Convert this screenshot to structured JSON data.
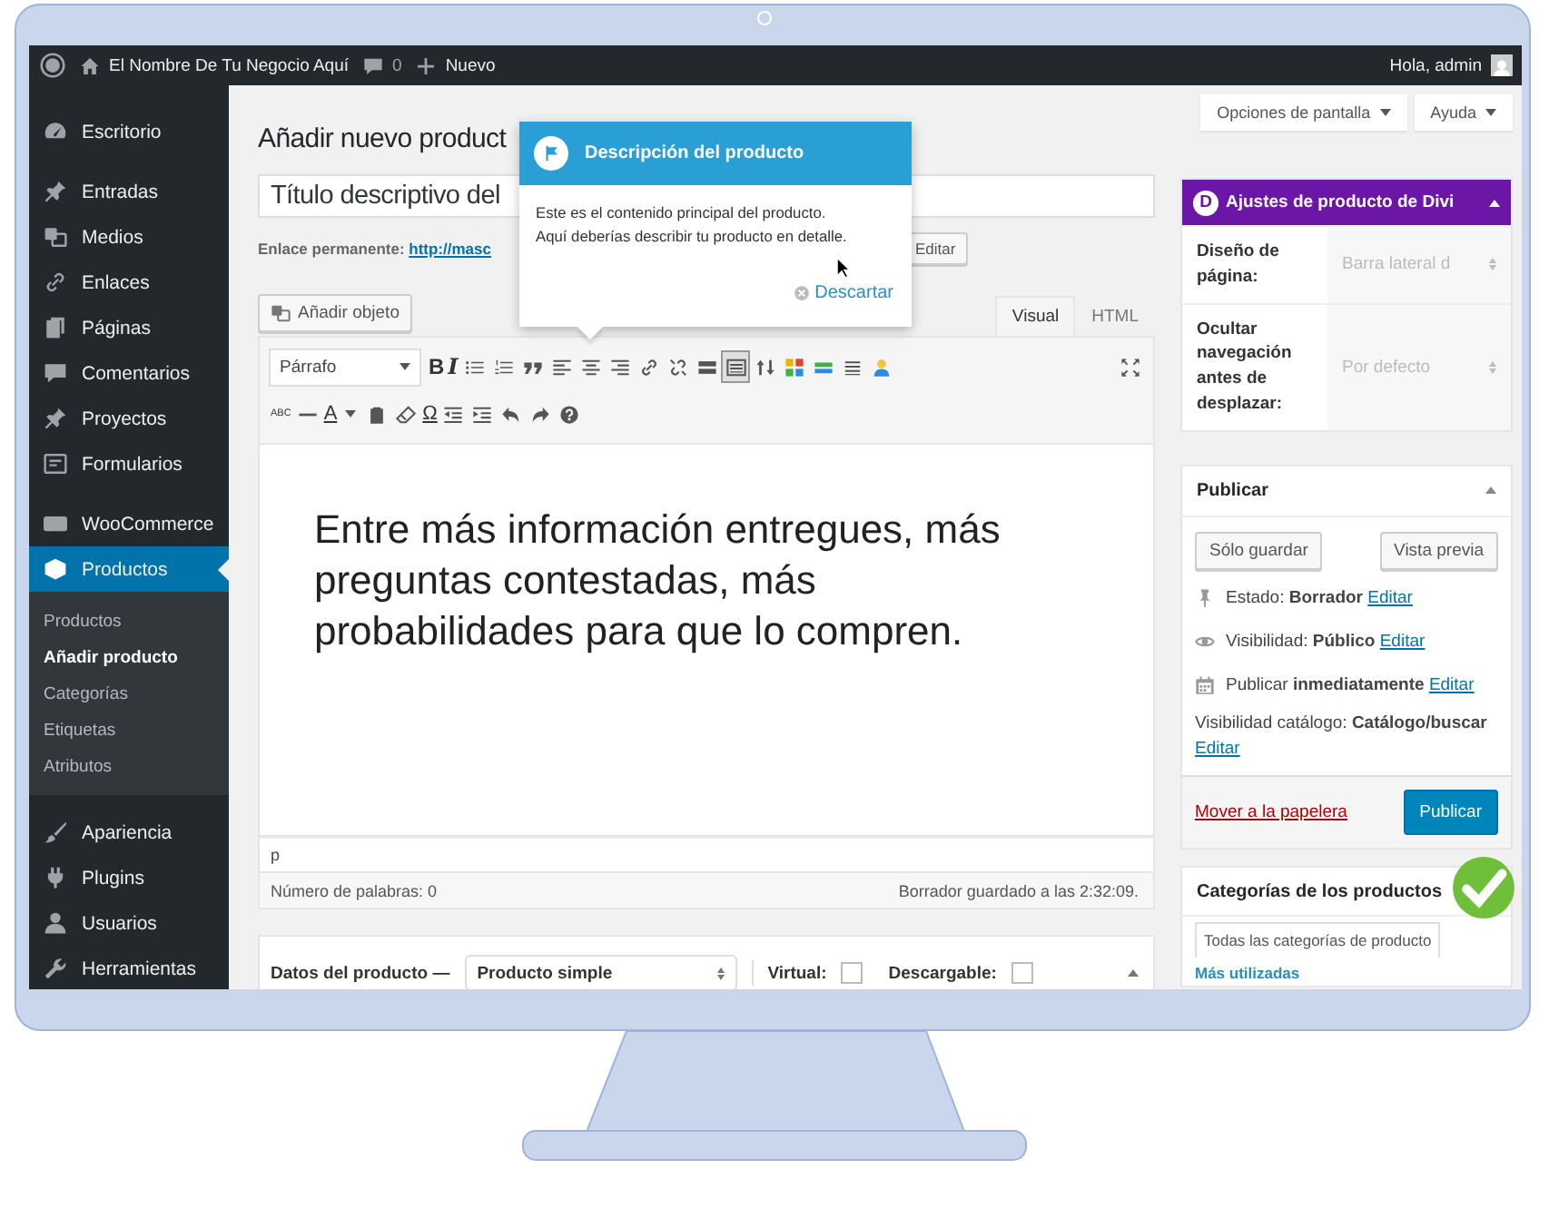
{
  "admin_bar": {
    "site_name": "El Nombre De Tu Negocio Aquí",
    "comments_count": "0",
    "new_label": "Nuevo",
    "greeting": "Hola, admin"
  },
  "sidebar": {
    "groups": [
      [
        {
          "label": "Escritorio",
          "selected": false
        }
      ],
      [
        {
          "label": "Entradas",
          "selected": false
        },
        {
          "label": "Medios",
          "selected": false
        },
        {
          "label": "Enlaces",
          "selected": false
        },
        {
          "label": "Páginas",
          "selected": false
        },
        {
          "label": "Comentarios",
          "selected": false
        },
        {
          "label": "Proyectos",
          "selected": false
        },
        {
          "label": "Formularios",
          "selected": false
        }
      ],
      [
        {
          "label": "WooCommerce",
          "selected": false
        },
        {
          "label": "Productos",
          "selected": true,
          "children": [
            {
              "label": "Productos",
              "selected": false
            },
            {
              "label": "Añadir producto",
              "selected": true
            },
            {
              "label": "Categorías",
              "selected": false
            },
            {
              "label": "Etiquetas",
              "selected": false
            },
            {
              "label": "Atributos",
              "selected": false
            }
          ]
        }
      ],
      [
        {
          "label": "Apariencia",
          "selected": false
        },
        {
          "label": "Plugins",
          "selected": false
        },
        {
          "label": "Usuarios",
          "selected": false
        },
        {
          "label": "Herramientas",
          "selected": false
        }
      ]
    ]
  },
  "screen_buttons": [
    "Opciones de pantalla",
    "Ayuda"
  ],
  "page_title": "Añadir nuevo product",
  "title_field": {
    "value": "Título descriptivo del"
  },
  "permalink": {
    "label": "Enlace permanente:",
    "url": "http://masc",
    "edit_button": "Editar"
  },
  "popover": {
    "title": "Descripción del producto",
    "lines": [
      "Este es el contenido principal del producto.",
      "Aquí deberías describir tu producto en detalle."
    ],
    "dismiss": "Descartar"
  },
  "editor": {
    "add_media": "Añadir objeto",
    "tabs": [
      {
        "label": "Visual",
        "selected": true
      },
      {
        "label": "HTML",
        "selected": false
      }
    ],
    "format": "Párrafo",
    "toolbar_rows": [
      [
        {
          "kind": "glyph",
          "label": "B",
          "pressed": false
        },
        {
          "kind": "glyph",
          "label": "I",
          "pressed": false
        },
        {
          "kind": "icon",
          "pressed": false
        },
        {
          "kind": "icon",
          "pressed": false
        },
        {
          "kind": "icon",
          "pressed": false
        },
        {
          "kind": "icon",
          "pressed": false
        },
        {
          "kind": "icon",
          "pressed": false
        },
        {
          "kind": "icon",
          "pressed": false
        },
        {
          "kind": "icon",
          "pressed": false
        },
        {
          "kind": "icon",
          "pressed": false
        },
        {
          "kind": "icon",
          "pressed": false
        },
        {
          "kind": "icon",
          "pressed": true
        },
        {
          "kind": "icon",
          "pressed": false
        },
        {
          "kind": "icon",
          "pressed": false
        },
        {
          "kind": "icon",
          "pressed": false
        },
        {
          "kind": "icon",
          "pressed": false
        },
        {
          "kind": "icon",
          "pressed": false
        }
      ],
      [
        {
          "kind": "glyph",
          "label": "ABC",
          "pressed": false
        },
        {
          "kind": "icon",
          "pressed": false
        },
        {
          "kind": "glyph",
          "label": "A",
          "pressed": false
        },
        {
          "kind": "icon",
          "pressed": false
        },
        {
          "kind": "icon",
          "pressed": false
        },
        {
          "kind": "glyph",
          "label": "Ω",
          "pressed": false
        },
        {
          "kind": "icon",
          "pressed": false
        },
        {
          "kind": "icon",
          "pressed": false
        },
        {
          "kind": "icon",
          "pressed": false
        },
        {
          "kind": "icon",
          "pressed": false
        },
        {
          "kind": "icon",
          "pressed": false
        }
      ]
    ],
    "content": "Entre más información entregues, más preguntas contestadas, más probabilidades para que lo compren.",
    "path": "p",
    "word_count": "Número de palabras: 0",
    "draft_saved": "Borrador guardado a las 2:32:09."
  },
  "product_data": {
    "label": "Datos del producto —",
    "type": "Producto simple",
    "virtual": {
      "label": "Virtual:",
      "checked": false
    },
    "downloadable": {
      "label": "Descargable:",
      "checked": false
    }
  },
  "divi_box": {
    "badge": "D",
    "title": "Ajustes de producto de Divi",
    "rows": [
      {
        "label": "Diseño de página:",
        "value": "Barra lateral d"
      },
      {
        "label": "Ocultar navegación antes de desplazar:",
        "value": "Por defecto"
      }
    ]
  },
  "publish_box": {
    "title": "Publicar",
    "save_draft": "Sólo guardar",
    "preview": "Vista previa",
    "status": {
      "label": "Estado:",
      "value": "Borrador",
      "link": "Editar"
    },
    "visibility": {
      "label": "Visibilidad:",
      "value": "Público",
      "link": "Editar"
    },
    "schedule": {
      "label": "Publicar",
      "value": "inmediatamente",
      "link": "Editar"
    },
    "catalog": {
      "label": "Visibilidad catálogo:",
      "value": "Catálogo/buscar",
      "link": "Editar"
    },
    "trash": "Mover a la papelera",
    "publish": "Publicar"
  },
  "categories_box": {
    "title": "Categorías de los productos",
    "tabs": [
      {
        "label": "Todas las categorías de producto",
        "selected": true
      },
      {
        "label": "Más utilizadas",
        "selected": false
      }
    ]
  }
}
